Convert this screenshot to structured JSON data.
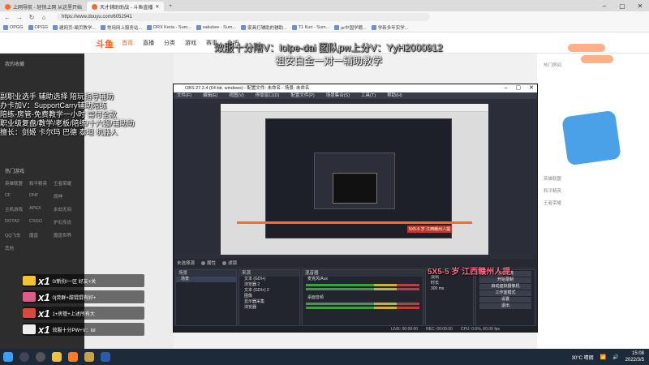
{
  "browser": {
    "tabs": [
      {
        "title": "上网导航 - 轻快上网 从这里开始",
        "active": false
      },
      {
        "title": "天才辅助助战 - 斗鱼直播",
        "active": true
      }
    ],
    "url": "https://www.douyu.com/6052941",
    "bookmarks": [
      "OPGG",
      "OPGG",
      "建网页-编页教学...",
      "常用网上服务站...",
      "DRX Keria - Sum...",
      "sakukee - Sum...",
      "家具打辅助的辅助...",
      "T1 Kuri - Sum...",
      "pr中国学籍...",
      "学新多年实学..."
    ]
  },
  "site": {
    "logo": "斗鱼",
    "nav": [
      "首页",
      "直播",
      "分类",
      "游戏",
      "赛事",
      "鱼吧"
    ],
    "left_title": "我的收藏",
    "left_section": "热门游戏",
    "left_grid": [
      "英雄联盟",
      "和平精英",
      "王者荣耀",
      "CF",
      "DNF",
      "原神",
      "主机游戏",
      "APEX",
      "永劫无间",
      "DOTA2",
      "CSGO",
      "炉石传说",
      "QQ飞车",
      "魔兽",
      "魔兽世界",
      "其他"
    ],
    "right_lines": [
      "热门房间",
      "英雄联盟",
      "和平精英",
      "王者荣耀"
    ]
  },
  "overlay": {
    "banner_line1": "效服十分陪V：lolpe-dai 团队pw上分V：YyH2000912",
    "banner_line2": "祖安白金一对一辅助教学",
    "left_lines": [
      "副职业选手 辅助选择 陪玩指导辅助",
      "办卡加V：SupportCarry辅助陪练",
      "陪练-房管-免费教学一小时 需付全款",
      "职业级复盘/教学/老板/陪练/十六强/辅助助",
      "擅长：剑姬 卡尔玛 巴德 泰坦 机器人"
    ]
  },
  "obs": {
    "title": "OBS 27.2.4 (64-bit, windows) - 配置文件: 未命名 - 场景: 未命名",
    "menu": [
      "文件(F)",
      "编辑(E)",
      "视图(V)",
      "停靠窗口(D)",
      "配置文件(P)",
      "场景集合(S)",
      "工具(T)",
      "帮助(H)"
    ],
    "scene_label": "未选择源",
    "scene_buttons": [
      "属性",
      "滤镜"
    ],
    "docks": {
      "scenes": {
        "header": "场景",
        "items": [
          "场景"
        ]
      },
      "sources": {
        "header": "来源",
        "items": [
          "文本 (GDI+)",
          "浏览器 2",
          "文本 (GDI+) 2",
          "图像",
          "显示器采集",
          "浏览器"
        ]
      },
      "mixer": {
        "header": "混音器",
        "items": [
          "麦克风/Aux",
          "桌面音频"
        ]
      },
      "controls": {
        "header": "控件",
        "buttons": [
          "停止推流",
          "开始录制",
          "启动虚拟摄像机",
          "工作室模式",
          "设置",
          "退出"
        ]
      }
    },
    "transition": {
      "label": "淡出",
      "duration_label": "时长",
      "duration": "300 ms"
    },
    "status": [
      "LIVE: 00:00:00",
      "REC: 00:00:00",
      "CPU: 0.6%, 60.00 fps"
    ],
    "preview_tag": "5X5-5 岁 江西赣州人提",
    "overlay_tag": "5X5-5 岁 江西赣州人提"
  },
  "gifts": [
    {
      "count": "x1",
      "text": "0/新份/一区 好友+关",
      "color": "#f2c230"
    },
    {
      "count": "x1",
      "text": "0|荧群+甜馄馄有好+",
      "color": "#e05a8a"
    },
    {
      "count": "x1",
      "text": "1+房管+上述所有大",
      "color": "#d9483a"
    },
    {
      "count": "x1",
      "text": "效服十分PW+V：lol",
      "color": "#eeeeee"
    }
  ],
  "taskbar": {
    "weather": "30°C 晴朗",
    "time": "15:08",
    "date": "2022/3/5"
  }
}
